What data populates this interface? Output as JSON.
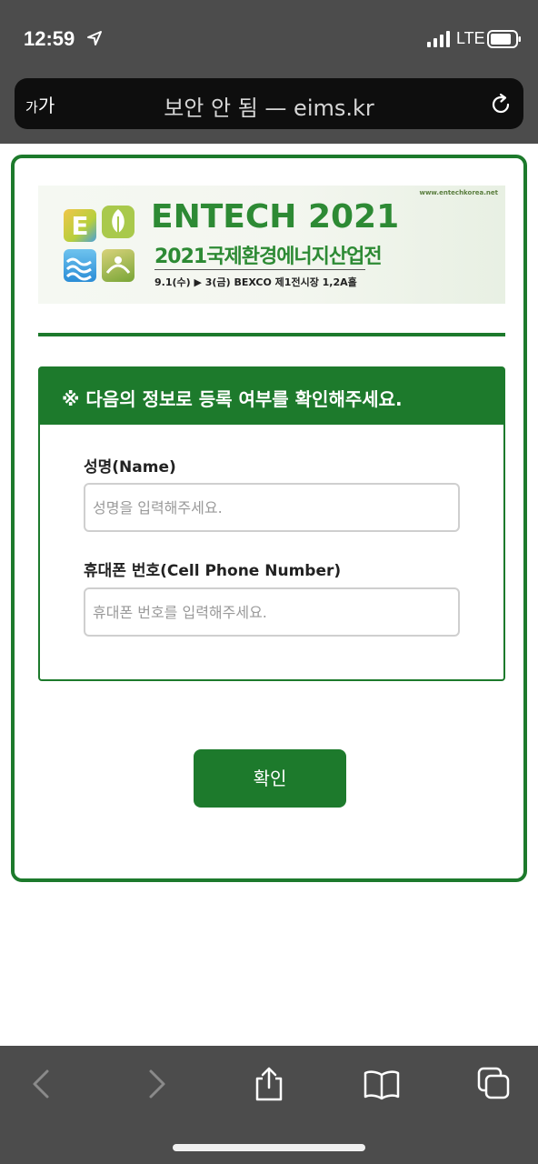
{
  "status_bar": {
    "time": "12:59",
    "network": "LTE"
  },
  "browser": {
    "text_size_label_small": "가",
    "text_size_label_large": "가",
    "url_text": "보안 안 됨 — eims.kr"
  },
  "banner": {
    "website": "www.entechkorea.net",
    "title": "ENTECH 2021",
    "subtitle": "2021국제환경에너지산업전",
    "dates": "9.1(수) ▶ 3(금) BEXCO 제1전시장 1,2A홀",
    "logo_letter": "E"
  },
  "form": {
    "notice": "※ 다음의 정보로 등록 여부를 확인해주세요.",
    "name_label": "성명(Name)",
    "name_placeholder": "성명을 입력해주세요.",
    "name_value": "",
    "phone_label": "휴대폰 번호(Cell Phone Number)",
    "phone_placeholder": "휴대폰 번호를 입력해주세요.",
    "phone_value": "",
    "confirm_label": "확인"
  },
  "toolbar": {
    "icons": [
      "back-icon",
      "forward-icon",
      "share-icon",
      "bookmarks-icon",
      "tabs-icon"
    ]
  },
  "colors": {
    "brand_green": "#1d7a2c",
    "chrome_gray": "#4c4c4c"
  }
}
